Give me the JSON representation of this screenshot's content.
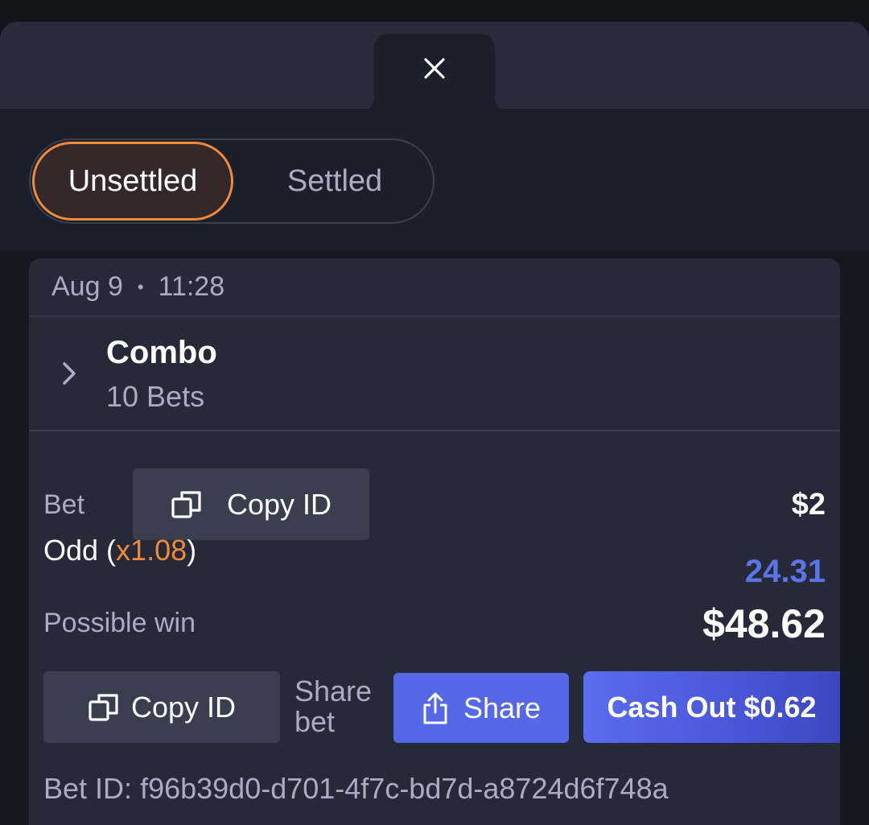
{
  "tabs": {
    "unsettled": "Unsettled",
    "settled": "Settled"
  },
  "card": {
    "date": "Aug 9",
    "time": "11:28",
    "combo_title": "Combo",
    "combo_sub": "10 Bets",
    "bet_label": "Bet",
    "copy_id_label": "Copy ID",
    "bet_amount": "$2",
    "odd_label": "Odd",
    "odd_multiplier": "x1.08",
    "odd_value": "24.31",
    "possible_win_label": "Possible win",
    "possible_win_value": "$48.62",
    "copy_id_label_2": "Copy ID",
    "share_bet_label": "Share bet",
    "share_label": "Share",
    "cashout_label": "Cash Out $0.62",
    "bet_id_label": "Bet ID:",
    "bet_id_value": "f96b39d0-d701-4f7c-bd7d-a8724d6f748a"
  },
  "icons": {
    "close": "close-icon",
    "chevron": "chevron-right-icon",
    "copy": "copy-icon",
    "share": "share-icon"
  },
  "colors": {
    "accent_orange": "#f08a3a",
    "accent_blue": "#5b6cf0",
    "odd_value": "#5d73e8"
  }
}
